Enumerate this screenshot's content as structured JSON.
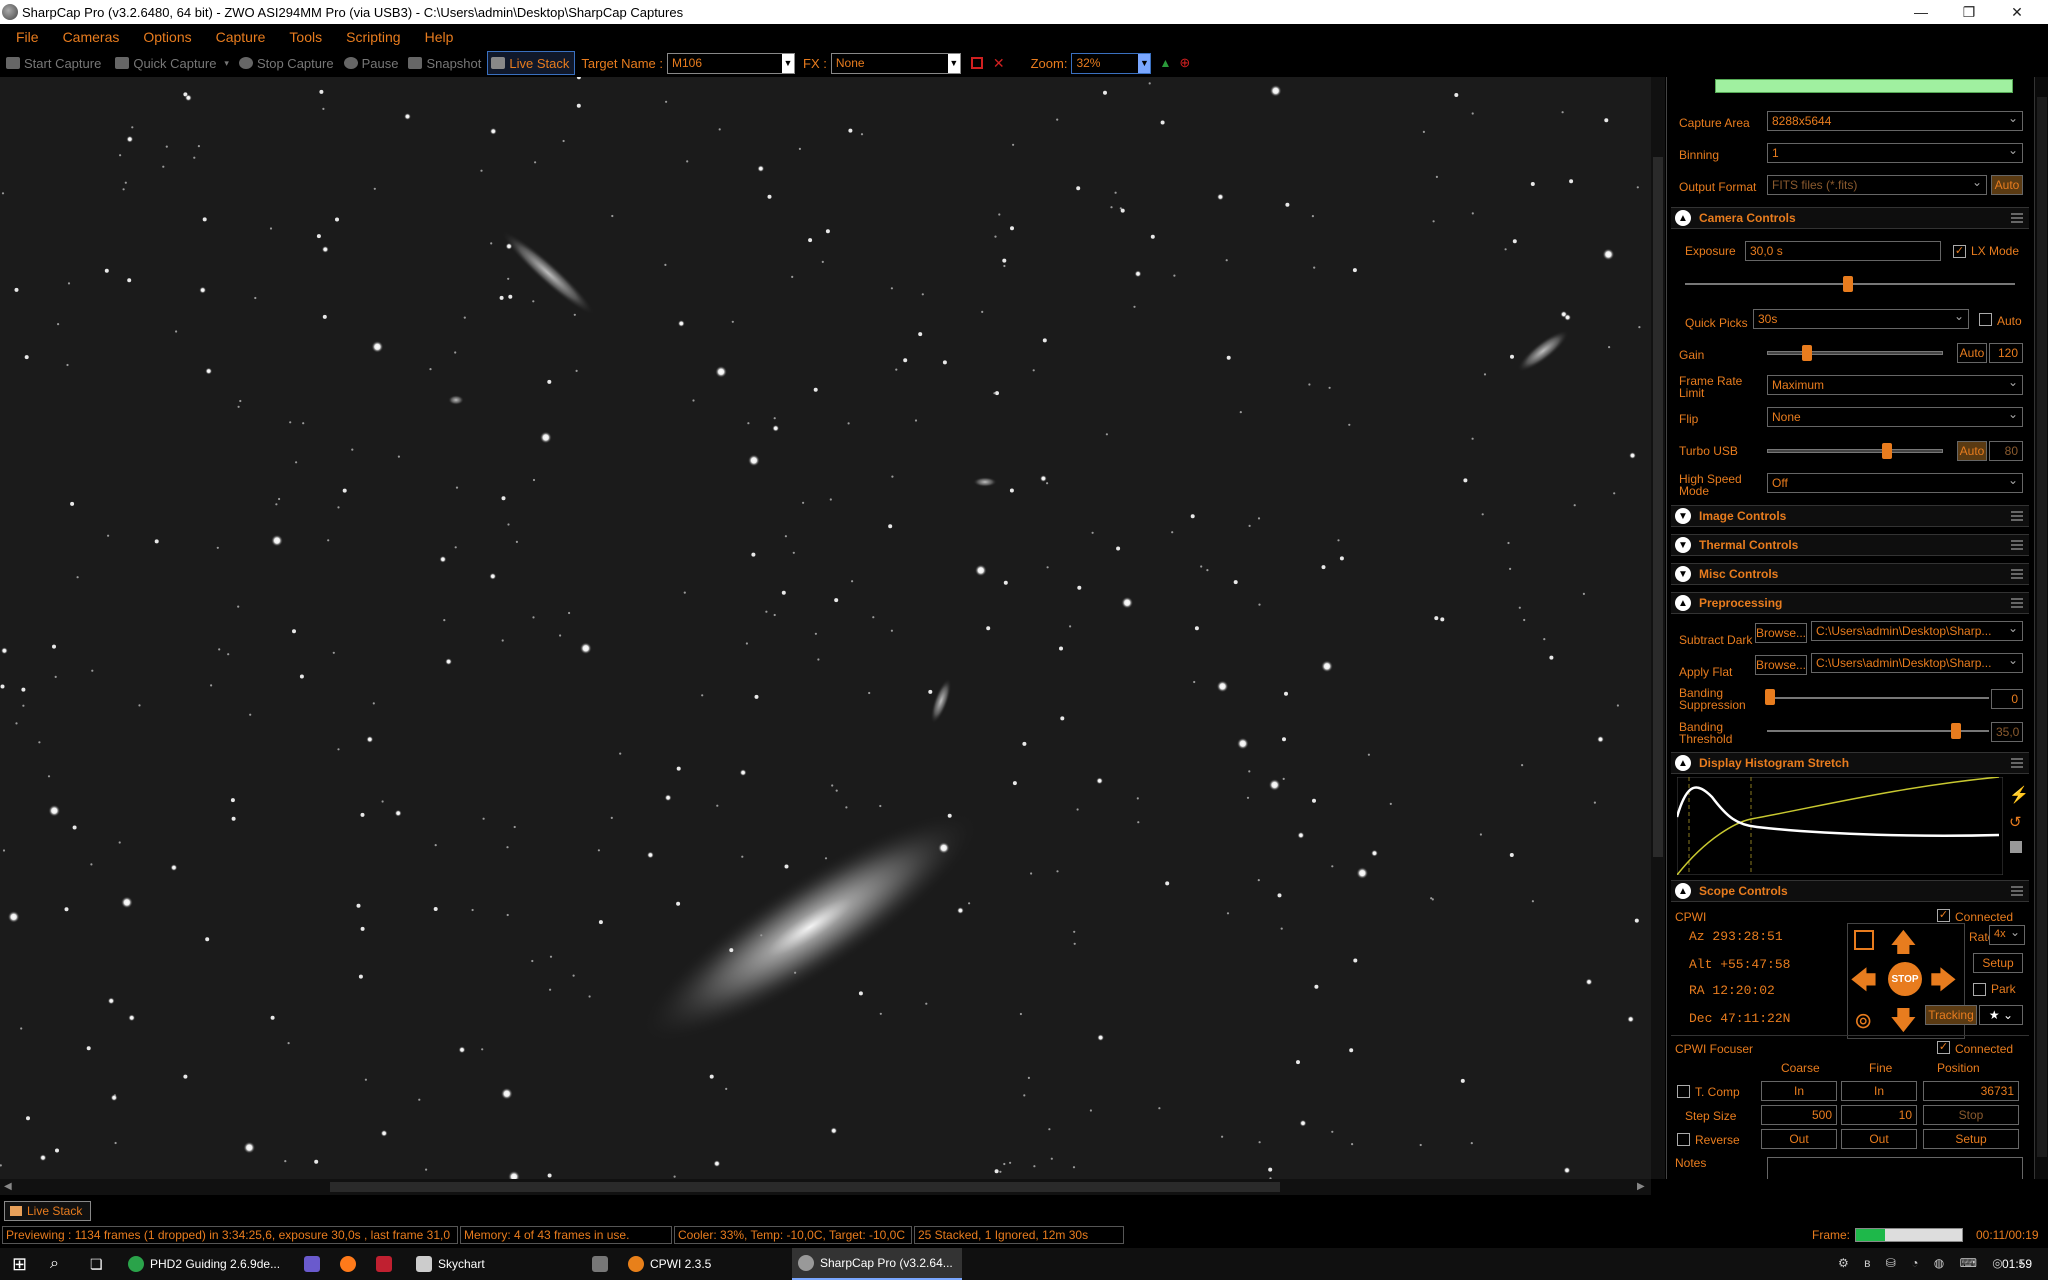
{
  "title_bar": {
    "title": "SharpCap Pro (v3.2.6480, 64 bit) - ZWO ASI294MM Pro (via USB3) - C:\\Users\\admin\\Desktop\\SharpCap Captures",
    "minimize": "—",
    "restore": "❐",
    "close": "✕"
  },
  "menu": [
    "File",
    "Cameras",
    "Options",
    "Capture",
    "Tools",
    "Scripting",
    "Help"
  ],
  "toolbar": {
    "start_capture": "Start Capture",
    "quick_capture": "Quick Capture",
    "stop_capture": "Stop Capture",
    "pause": "Pause",
    "snapshot": "Snapshot",
    "live_stack": "Live Stack",
    "target_label": "Target Name :",
    "target_value": "M106",
    "fx_label": "FX :",
    "fx_value": "None",
    "zoom_label": "Zoom:",
    "zoom_value": "32%"
  },
  "panel": {
    "capture_area_label": "Capture Area",
    "capture_area_value": "8288x5644",
    "binning_label": "Binning",
    "binning_value": "1",
    "output_format_label": "Output Format",
    "output_format_value": "FITS files (*.fits)",
    "output_auto": "Auto",
    "camera_controls": "Camera Controls",
    "exposure_label": "Exposure",
    "exposure_value": "30,0 s",
    "lx_mode": "LX Mode",
    "quick_picks_label": "Quick Picks",
    "quick_picks_value": "30s",
    "quick_auto": "Auto",
    "gain_label": "Gain",
    "gain_auto": "Auto",
    "gain_value": "120",
    "frame_rate_label_1": "Frame Rate",
    "frame_rate_label_2": "Limit",
    "frame_rate_value": "Maximum",
    "flip_label": "Flip",
    "flip_value": "None",
    "turbo_label": "Turbo USB",
    "turbo_auto": "Auto",
    "turbo_value": "80",
    "high_speed_label_1": "High Speed",
    "high_speed_label_2": "Mode",
    "high_speed_value": "Off",
    "image_controls": "Image Controls",
    "thermal_controls": "Thermal Controls",
    "misc_controls": "Misc Controls",
    "preprocessing": "Preprocessing",
    "subtract_dark_label": "Subtract Dark",
    "browse": "Browse...",
    "dark_path": "C:\\Users\\admin\\Desktop\\Sharp...",
    "apply_flat_label": "Apply Flat",
    "flat_path": "C:\\Users\\admin\\Desktop\\Sharp...",
    "banding_sup_label_1": "Banding",
    "banding_sup_label_2": "Suppression",
    "banding_sup_value": "0",
    "banding_thr_label_1": "Banding",
    "banding_thr_label_2": "Threshold",
    "banding_thr_value": "35,0",
    "histogram": "Display Histogram Stretch",
    "scope_controls": "Scope Controls",
    "scope_name": "CPWI",
    "connected": "Connected",
    "az": "Az  293:28:51",
    "alt": "Alt +55:47:58",
    "ra": "RA  12:20:02",
    "dec": "Dec 47:11:22N",
    "rate_label": "Rate:",
    "rate_value": "4x",
    "setup": "Setup",
    "park": "Park",
    "stop": "STOP",
    "tracking": "Tracking",
    "focuser_name": "CPWI Focuser",
    "coarse": "Coarse",
    "fine": "Fine",
    "position": "Position",
    "tcomp": "T. Comp",
    "in": "In",
    "position_value": "36731",
    "step_size_label": "Step Size",
    "coarse_step": "500",
    "fine_step": "10",
    "stop_btn": "Stop",
    "reverse": "Reverse",
    "out": "Out",
    "focus_setup": "Setup",
    "notes": "Notes"
  },
  "bottom_tab": "Live Stack",
  "status": {
    "previewing": "Previewing : 1134 frames (1 dropped) in 3:34:25,6, exposure 30,0s , last frame 31,0",
    "memory": "Memory: 4 of 43 frames in use.",
    "cooler": "Cooler: 33%, Temp: -10,0C, Target: -10,0C",
    "stacked": "25 Stacked, 1 Ignored, 12m 30s",
    "frame_label": "Frame:",
    "frame_progress": 0.27,
    "elapsed": "00:11/00:19"
  },
  "taskbar": {
    "phd2": "PHD2 Guiding 2.6.9de...",
    "skychart": "Skychart",
    "cpwi": "CPWI 2.3.5",
    "sharpcap": "SharpCap Pro (v3.2.64...",
    "clock": "01:59"
  },
  "colors": {
    "accent": "#e87c1e",
    "background": "#000000",
    "sky": "#1a1a1a"
  }
}
